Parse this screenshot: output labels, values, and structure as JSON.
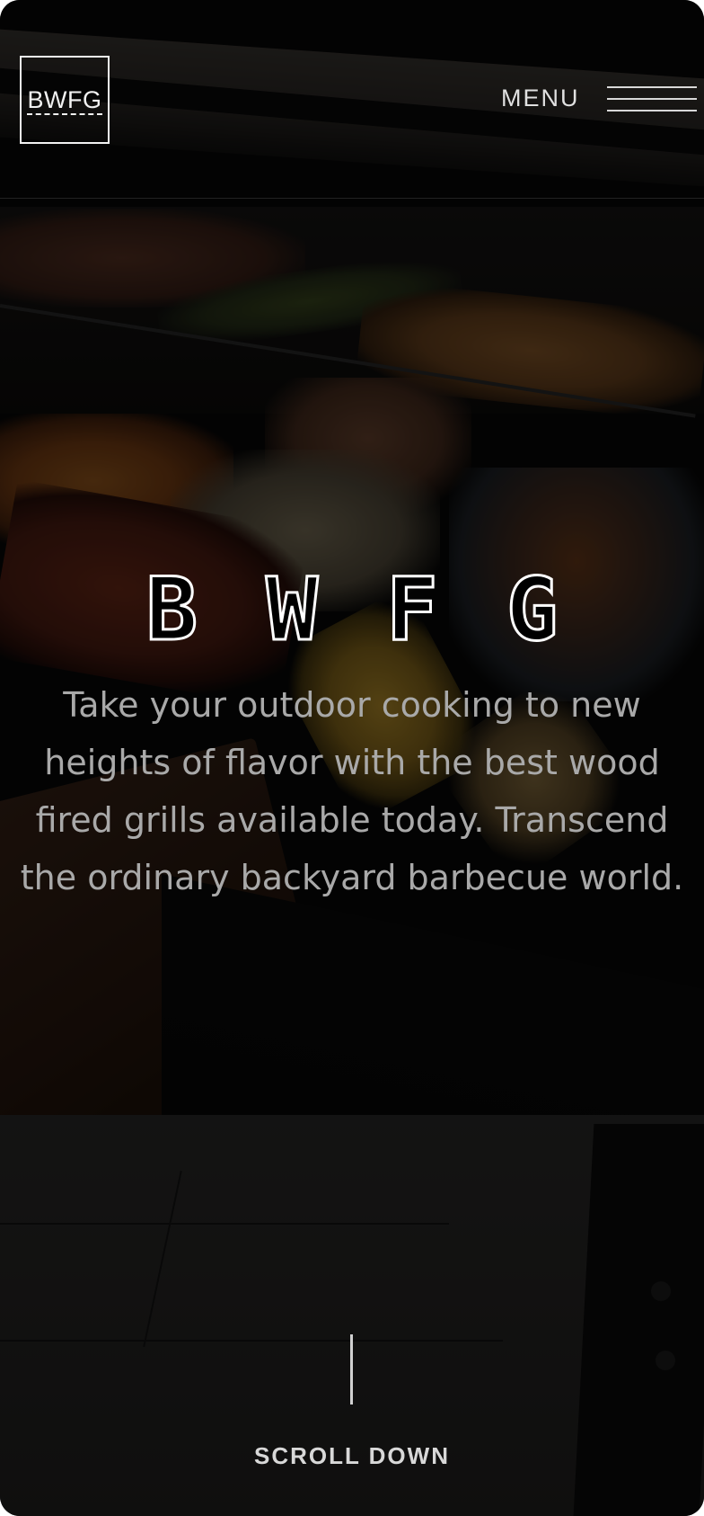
{
  "header": {
    "logo_text": "BWFG",
    "menu_label": "MENU"
  },
  "hero": {
    "title_letters": [
      "B",
      "W",
      "F",
      "G"
    ],
    "tagline": "Take your outdoor cooking to new heights of flavor with the best wood fired grills available today. Transcend the ordinary backyard barbecue world."
  },
  "scroll": {
    "label": "SCROLL DOWN"
  },
  "icons": {
    "menu": "hamburger-menu-icon",
    "scroll": "scroll-line-indicator"
  },
  "colors": {
    "text_primary": "#f2f2f2",
    "tagline": "#a9a9a9",
    "overlay": "#000000"
  }
}
